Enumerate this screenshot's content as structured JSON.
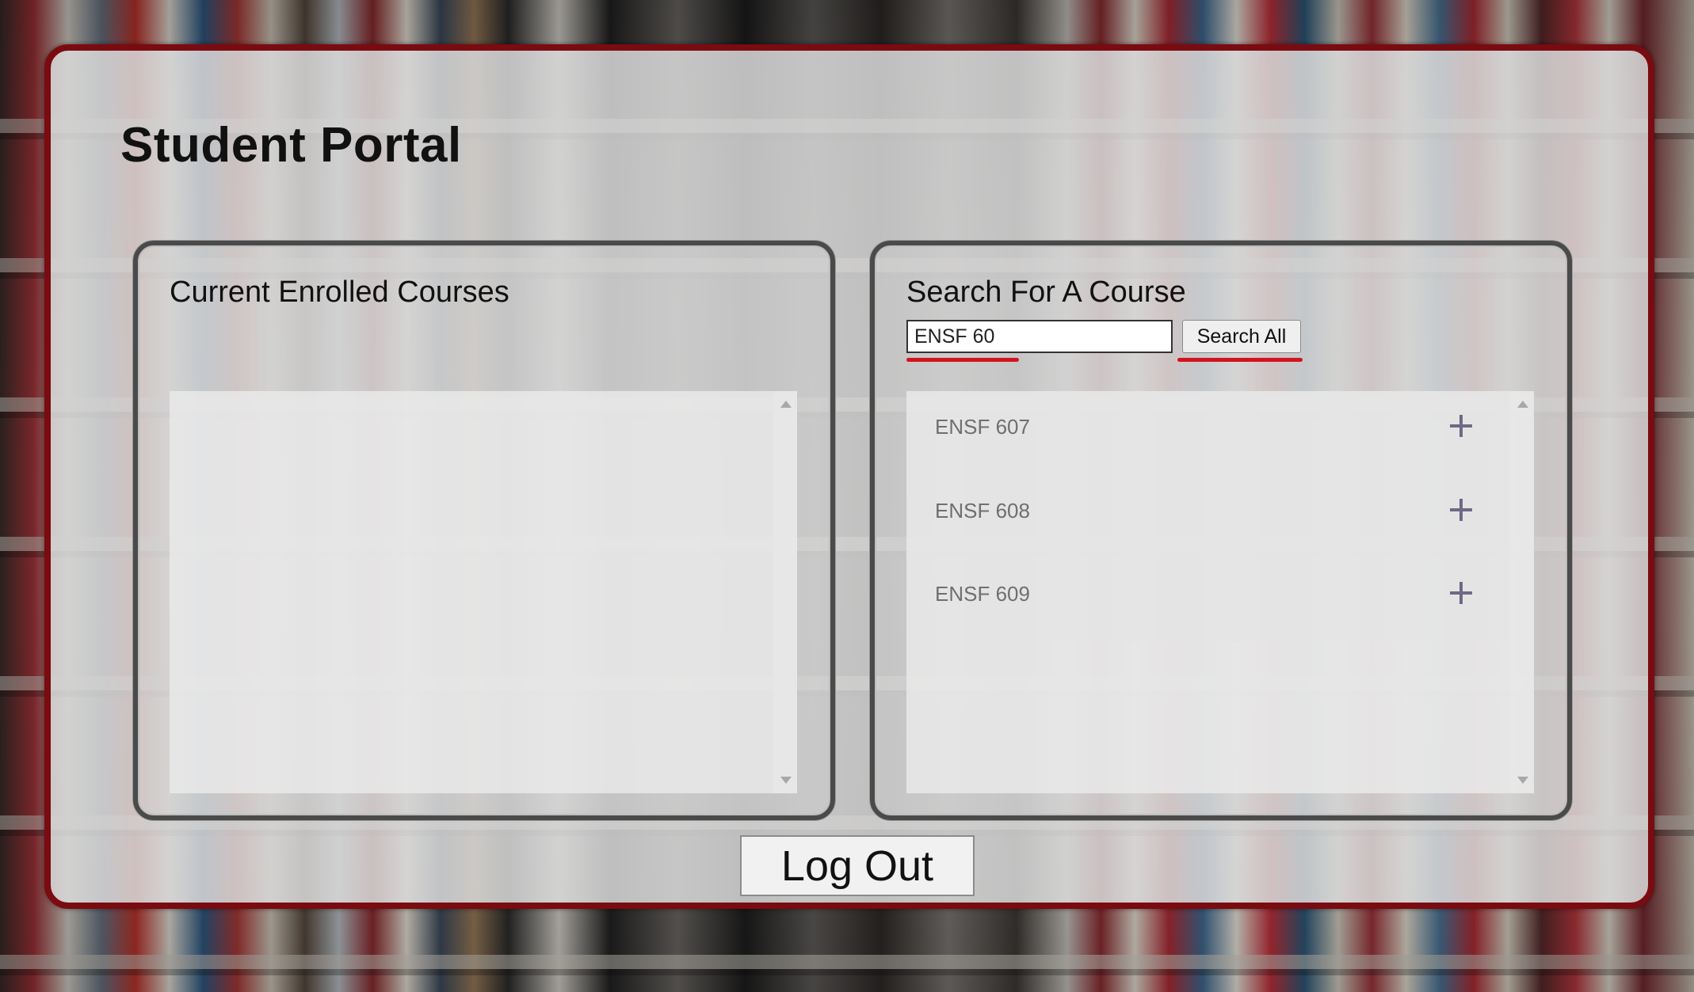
{
  "portal": {
    "title": "Student Portal"
  },
  "enrolled": {
    "heading": "Current Enrolled Courses",
    "courses": []
  },
  "search": {
    "heading": "Search For A Course",
    "input_value": "ENSF 60",
    "button_label": "Search All",
    "results": [
      {
        "label": "ENSF 607"
      },
      {
        "label": "ENSF 608"
      },
      {
        "label": "ENSF 609"
      }
    ]
  },
  "logout": {
    "label": "Log Out"
  },
  "colors": {
    "frame_border": "#7a0b10",
    "spellcheck_underline": "#d3131f",
    "add_icon": "#6d6a86"
  },
  "icons": {
    "add": "plus-icon",
    "scroll_up": "triangle-up-icon",
    "scroll_down": "triangle-down-icon"
  }
}
